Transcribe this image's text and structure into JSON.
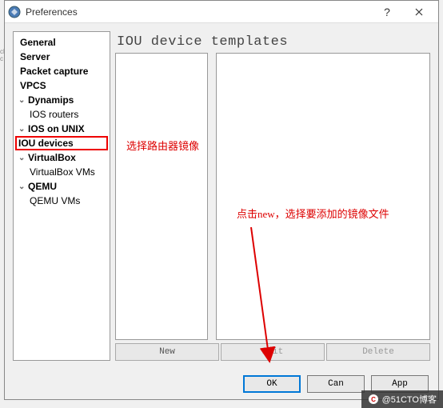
{
  "titlebar": {
    "title": "Preferences"
  },
  "tree": {
    "general": "General",
    "server": "Server",
    "packet_capture": "Packet capture",
    "vpcs": "VPCS",
    "dynamips": "Dynamips",
    "ios_routers": "IOS routers",
    "ios_on_unix": "IOS on UNIX",
    "iou_devices": "IOU devices",
    "virtualbox": "VirtualBox",
    "virtualbox_vms": "VirtualBox VMs",
    "qemu": "QEMU",
    "qemu_vms": "QEMU VMs"
  },
  "main": {
    "header": "IOU device templates",
    "buttons": {
      "new": "New",
      "edit": "Edit",
      "delete": "Delete"
    }
  },
  "footer": {
    "ok": "OK",
    "cancel": "Can",
    "apply": "App"
  },
  "annotations": {
    "ann1": "选择路由器镜像",
    "ann2": "点击new，选择要添加的镜像文件"
  },
  "watermark": {
    "text": "@51CTO博客"
  }
}
